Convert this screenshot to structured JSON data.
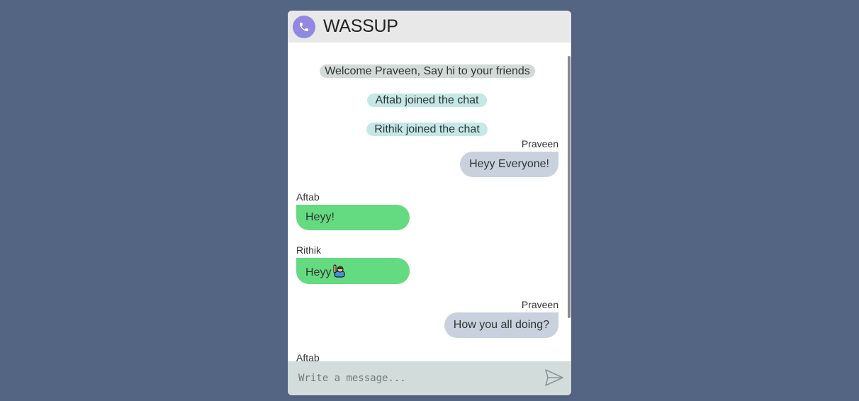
{
  "header": {
    "app_title": "WASSUP",
    "logo_icon": "phone-icon",
    "logo_color": "#9188e2"
  },
  "messages": {
    "notices": [
      {
        "text": "Welcome Praveen, Say hi to your friends",
        "kind": "welcome"
      },
      {
        "text": "Aftab joined the chat",
        "kind": "joined"
      },
      {
        "text": "Rithik joined the chat",
        "kind": "joined"
      }
    ],
    "chat": [
      {
        "sender": "Praveen",
        "text": "Heyy Everyone!",
        "direction": "outgoing"
      },
      {
        "sender": "Aftab",
        "text": "Heyy!",
        "direction": "incoming"
      },
      {
        "sender": "Rithik",
        "text": "Heyy",
        "direction": "incoming",
        "emoji": "raising-hand-emoji"
      },
      {
        "sender": "Praveen",
        "text": "How you all doing?",
        "direction": "outgoing"
      },
      {
        "sender": "Aftab",
        "text": "",
        "direction": "incoming"
      }
    ]
  },
  "composer": {
    "placeholder": "Write a message...",
    "value": "",
    "send_icon": "send-icon"
  },
  "colors": {
    "background": "#536583",
    "outgoing_bubble": "#c8d1dd",
    "incoming_bubble": "#64db81",
    "welcome_notice": "#d3dbd9",
    "joined_notice": "#c3e8e6",
    "composer_bg": "#d2dcdb"
  }
}
